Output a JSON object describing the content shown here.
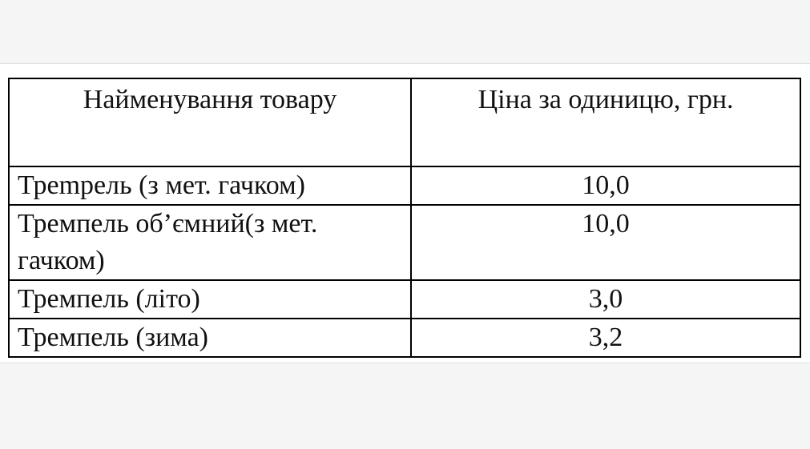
{
  "table": {
    "headers": [
      "Найменування товару",
      "Ціна за одиницю, грн."
    ],
    "rows": [
      {
        "name": "Трempель (з мет. гачком)",
        "price": "10,0"
      },
      {
        "name": "Тремпель об’ємний(з мет. гачком)",
        "price": "10,0"
      },
      {
        "name": "Тремпель (літо)",
        "price": "3,0"
      },
      {
        "name": "Тремпель (зима)",
        "price": "3,2"
      }
    ]
  }
}
